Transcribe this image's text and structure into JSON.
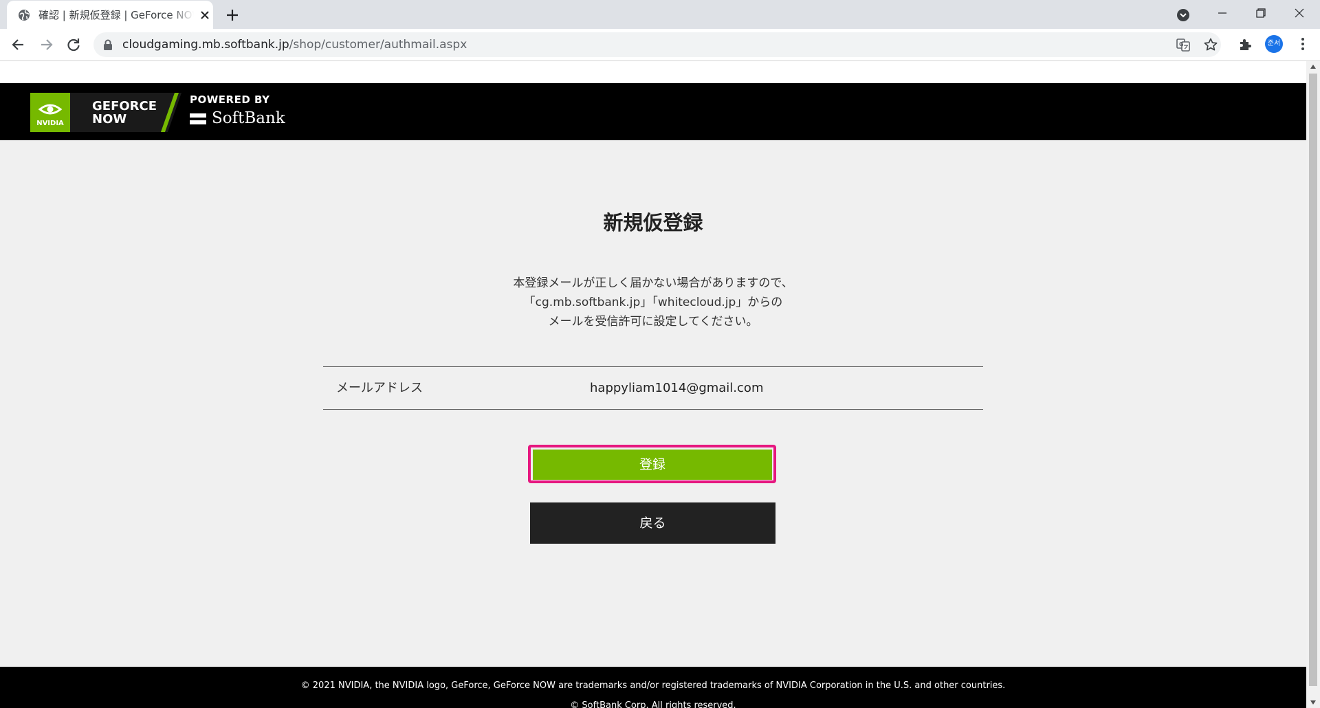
{
  "browser": {
    "tab_title": "確認 | 新規仮登録 | GeForce NOW",
    "url_host": "cloudgaming.mb.softbank.jp",
    "url_path": "/shop/customer/authmail.aspx",
    "profile_initials": "준서"
  },
  "header": {
    "logo_text_brand": "NVIDIA",
    "logo_text_line1": "GEFORCE",
    "logo_text_line2": "NOW",
    "powered_by": "POWERED BY",
    "softbank": "SoftBank"
  },
  "main": {
    "title": "新規仮登録",
    "notice_lines": [
      "本登録メールが正しく届かない場合がありますので、",
      "「cg.mb.softbank.jp」「whitecloud.jp」からの",
      "メールを受信許可に設定してください。"
    ],
    "email_label": "メールアドレス",
    "email_value": "happyliam1014@gmail.com",
    "register_label": "登録",
    "back_label": "戻る"
  },
  "footer": {
    "trademark": "© 2021 NVIDIA, the NVIDIA logo, GeForce, GeForce NOW are trademarks and/or registered trademarks of NVIDIA Corporation in the U.S. and other countries.",
    "copyright": "© SoftBank Corp. All rights reserved."
  },
  "colors": {
    "accent_green": "#76b900",
    "highlight_pink": "#e6177f",
    "header_black": "#000000"
  },
  "icons": [
    "globe-icon",
    "close-icon",
    "plus-icon",
    "tab-search-icon",
    "minimize-icon",
    "maximize-icon",
    "window-close-icon",
    "back-arrow-icon",
    "forward-arrow-icon",
    "reload-icon",
    "lock-icon",
    "translate-icon",
    "star-icon",
    "extensions-icon",
    "kebab-menu-icon"
  ]
}
